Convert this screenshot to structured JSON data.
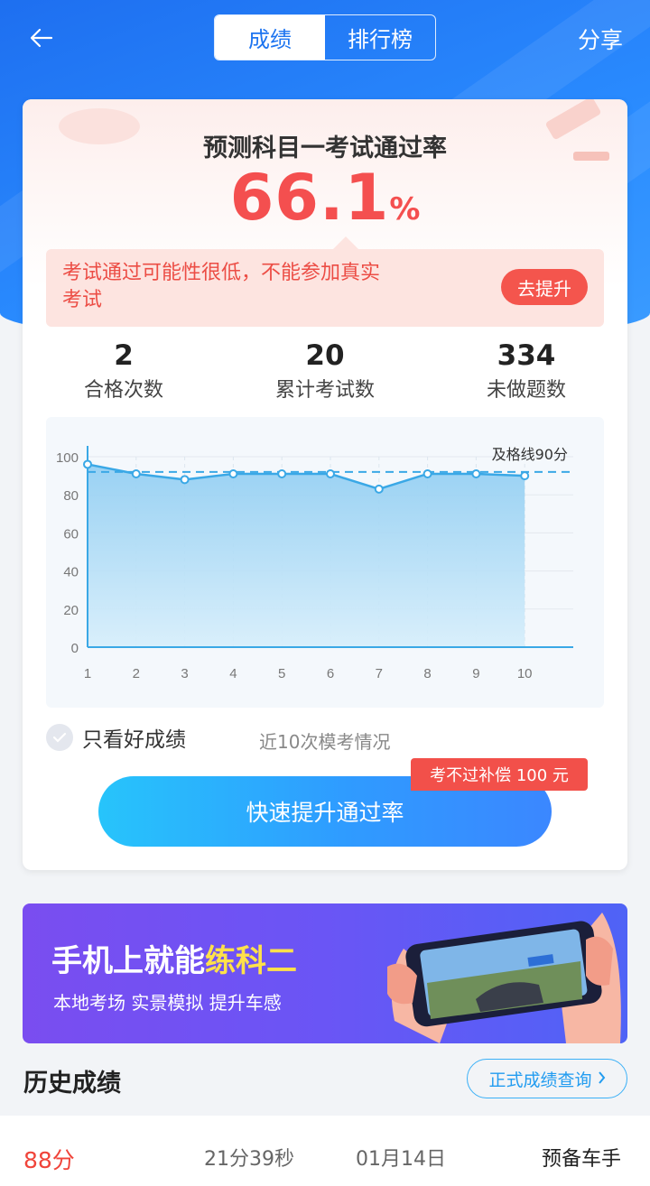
{
  "header": {
    "tabs": [
      {
        "label": "成绩",
        "active": true
      },
      {
        "label": "排行榜",
        "active": false
      }
    ],
    "share_label": "分享"
  },
  "summary": {
    "title": "预测科目一考试通过率",
    "rate_value": "66.1",
    "rate_unit": "%",
    "alert_text": "考试通过可能性很低，不能参加真实考试",
    "improve_label": "去提升"
  },
  "stats": [
    {
      "value": "2",
      "label": "合格次数"
    },
    {
      "value": "20",
      "label": "累计考试数"
    },
    {
      "value": "334",
      "label": "未做题数"
    }
  ],
  "chart_data": {
    "type": "area",
    "x": [
      1,
      2,
      3,
      4,
      5,
      6,
      7,
      8,
      9,
      10
    ],
    "series": [
      {
        "values": [
          96,
          91,
          88,
          91,
          91,
          91,
          83,
          91,
          91,
          90
        ]
      }
    ],
    "ylim": [
      0,
      100
    ],
    "yticks": [
      0,
      20,
      40,
      60,
      80,
      100
    ],
    "reference_line": {
      "value": 92,
      "label": "及格线90分"
    },
    "grid": true
  },
  "filter": {
    "label": "只看好成绩",
    "note": "近10次模考情况"
  },
  "compensation_badge": "考不过补偿 100 元",
  "main_button": "快速提升通过率",
  "banner": {
    "title_prefix": "手机上就能",
    "title_highlight": "练科二",
    "subtitle": "本地考场 实景模拟 提升车感"
  },
  "history": {
    "title": "历史成绩",
    "official_label": "正式成绩查询",
    "rows": [
      {
        "score": "88分",
        "duration": "21分39秒",
        "date": "01月14日",
        "rank": "预备车手"
      }
    ]
  },
  "colors": {
    "primary": "#1e6ff0",
    "accent_red": "#f44f4f",
    "chart_line": "#3aa8e6"
  }
}
